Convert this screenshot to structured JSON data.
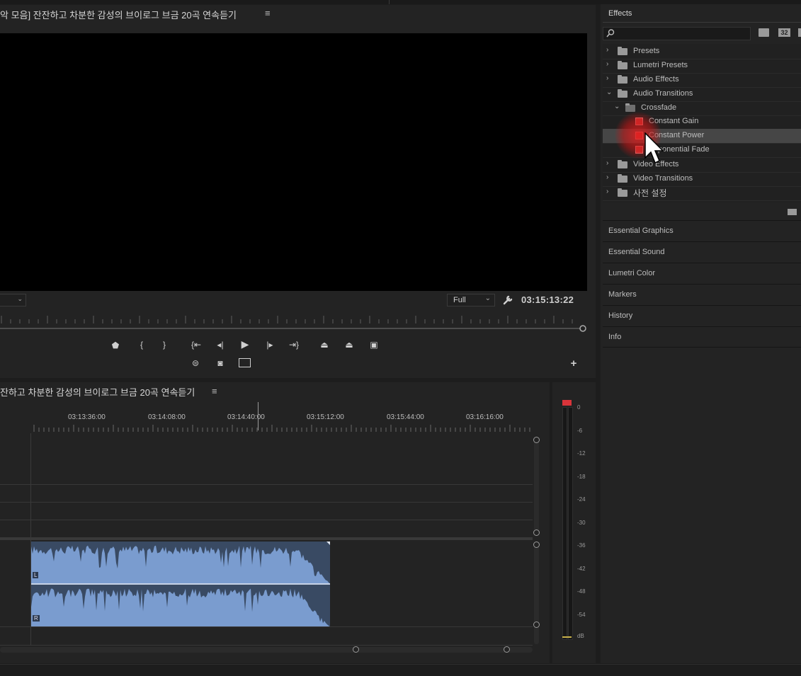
{
  "program_monitor": {
    "title": "악 모음] 잔잔하고 차분한 감성의 브이로그 브금 20곡 연속듣기",
    "resolution": "Full",
    "timecode": "03:15:13:22"
  },
  "timeline": {
    "title": "잔하고 차분한 감성의 브이로그 브금 20곡 연속듣기",
    "ruler_labels": [
      "03:13:36:00",
      "03:14:08:00",
      "03:14:40:00",
      "03:15:12:00",
      "03:15:44:00",
      "03:16:16:00"
    ],
    "track_labels": [
      "L",
      "R"
    ]
  },
  "meter": {
    "scale": [
      "0",
      "-6",
      "-12",
      "-18",
      "-24",
      "-30",
      "-36",
      "-42",
      "-48",
      "-54",
      "dB"
    ]
  },
  "effects": {
    "title": "Effects",
    "search_placeholder": "",
    "badge_32": "32",
    "tree": [
      {
        "label": "Presets"
      },
      {
        "label": "Lumetri Presets"
      },
      {
        "label": "Audio Effects"
      },
      {
        "label": "Audio Transitions"
      },
      {
        "label": "Crossfade"
      },
      {
        "label": "Constant Gain"
      },
      {
        "label": "Constant Power"
      },
      {
        "label": "Exponential Fade"
      },
      {
        "label": "Video Effects"
      },
      {
        "label": "Video Transitions"
      },
      {
        "label": "사전 설정"
      }
    ],
    "sections": [
      "Essential Graphics",
      "Essential Sound",
      "Lumetri Color",
      "Markers",
      "History",
      "Info"
    ]
  }
}
